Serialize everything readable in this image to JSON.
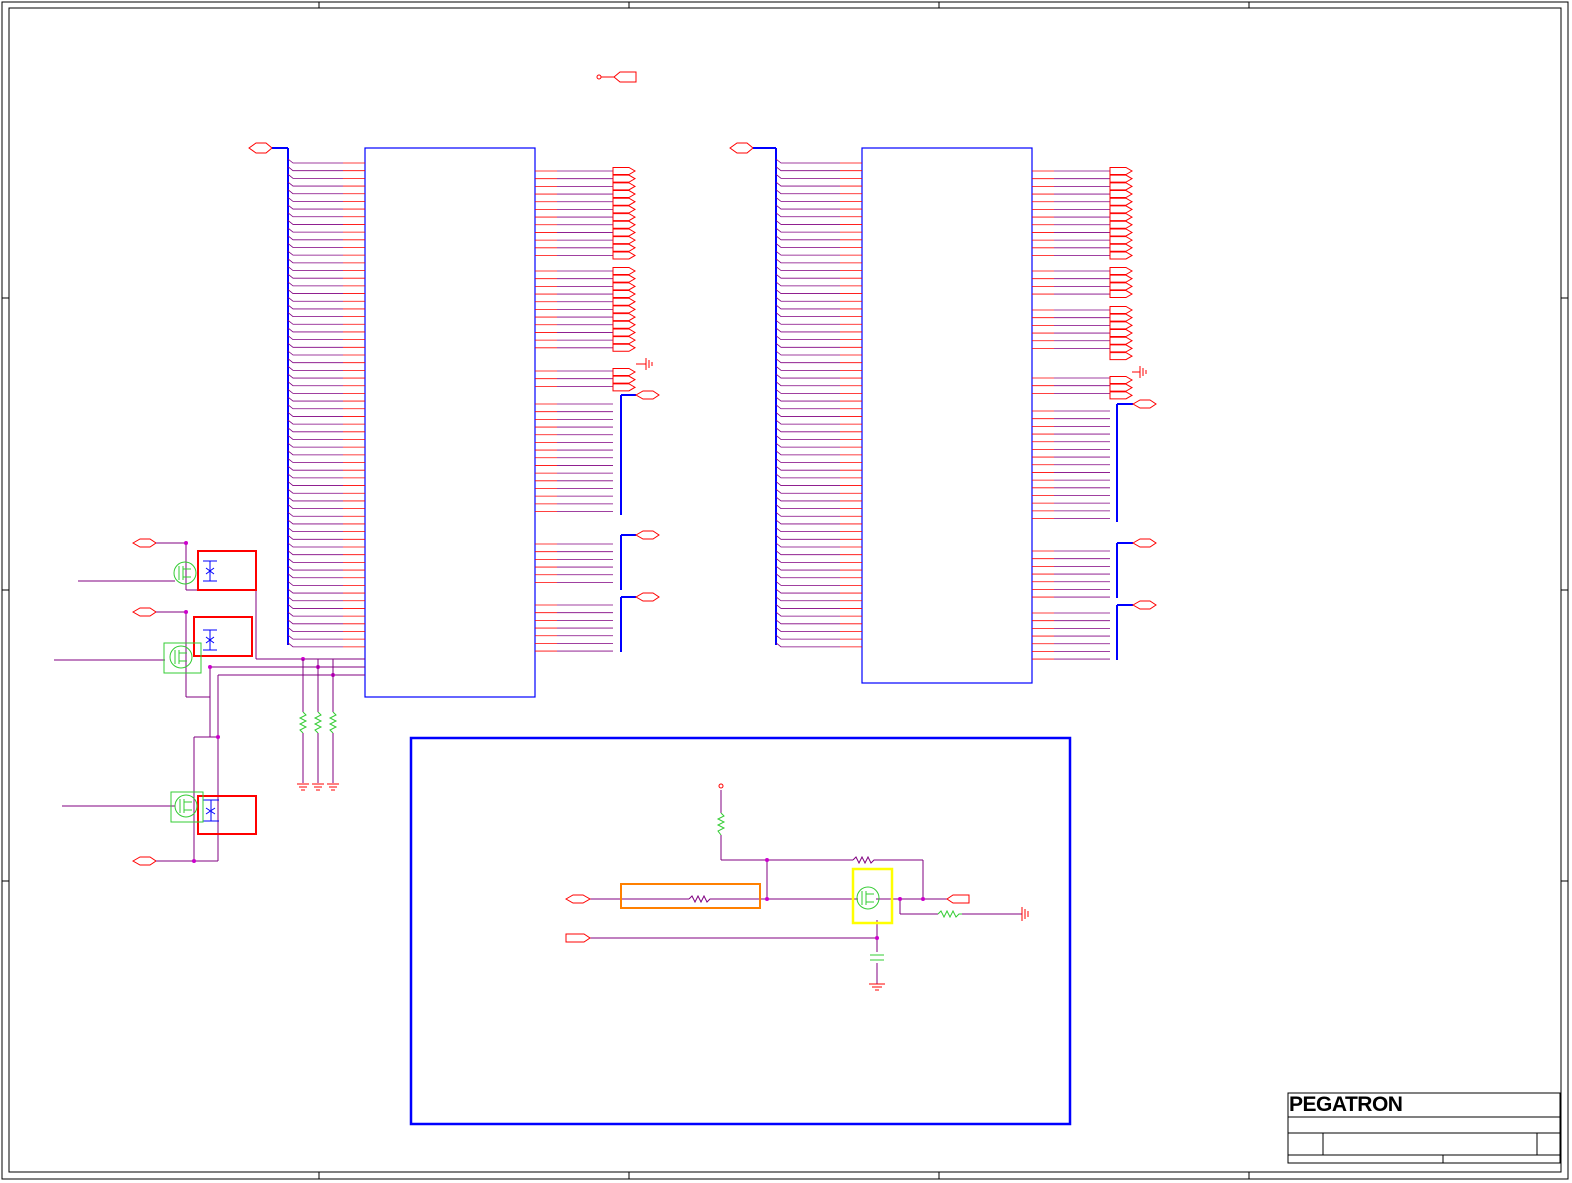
{
  "title_block": {
    "company_logo": "PEGATRON"
  },
  "colors": {
    "border": "#000000",
    "component_outline": "#0000ff",
    "net_wire": "#ff0000",
    "junction_wire": "#800080",
    "transistor": "#33cc33",
    "highlight_red": "#ff0000",
    "highlight_orange": "#ff8000",
    "highlight_yellow": "#ffff00",
    "subcircuit_frame": "#0000ff"
  },
  "icons": [
    "offpage-connector-icon",
    "ground-icon",
    "resistor-icon",
    "capacitor-icon",
    "mosfet-icon",
    "power-pin-icon"
  ]
}
